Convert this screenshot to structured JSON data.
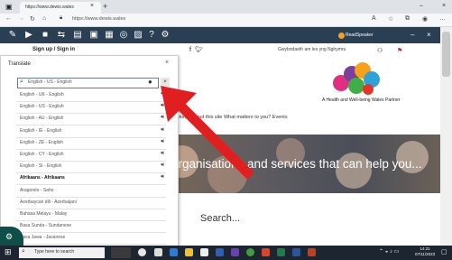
{
  "browser": {
    "tab_title": "https://www.dewis.wales",
    "url": "https://www.dewis.wales"
  },
  "site": {
    "signup_label": "Sign up / Sign in",
    "wales_label": "Gwybodaeth am les yng Nghymru",
    "tagline": "A Health and Well-being Wales Partner",
    "nav_text": "Home  About this site  What matters to you?  Events",
    "hero_text": "organisations and services that can help you...",
    "search_title": "Search...",
    "rs_logo": "ReadSpeaker"
  },
  "translate": {
    "title": "Translate",
    "search_value": "English - US - English",
    "languages": [
      {
        "label": "English - UK - English",
        "selected": false
      },
      {
        "label": "English - US - English",
        "selected": false
      },
      {
        "label": "English - AU - English",
        "selected": false
      },
      {
        "label": "English - IE - English",
        "selected": false
      },
      {
        "label": "English - ZE - English",
        "selected": false
      },
      {
        "label": "English - CY - English",
        "selected": false
      },
      {
        "label": "English - SI - English",
        "selected": false
      },
      {
        "label": "Afrikaans - Afrikaans",
        "selected": true
      },
      {
        "label": "Aragonés - Saho",
        "selected": false
      },
      {
        "label": "Azerbaycan dili - Azerbaijani",
        "selected": false
      },
      {
        "label": "Bahasa Melayu - Malay",
        "selected": false
      },
      {
        "label": "Basa Sunda - Sundanese",
        "selected": false
      },
      {
        "label": "Basa Jawa - Javanese",
        "selected": false
      }
    ]
  },
  "taskbar": {
    "search_placeholder": "Type here to search",
    "time": "14:21",
    "date": "07/11/2023"
  },
  "colors": {
    "toolbar": "#2a3e54",
    "arrow": "#e02020",
    "taskbar": "#1c2530"
  }
}
